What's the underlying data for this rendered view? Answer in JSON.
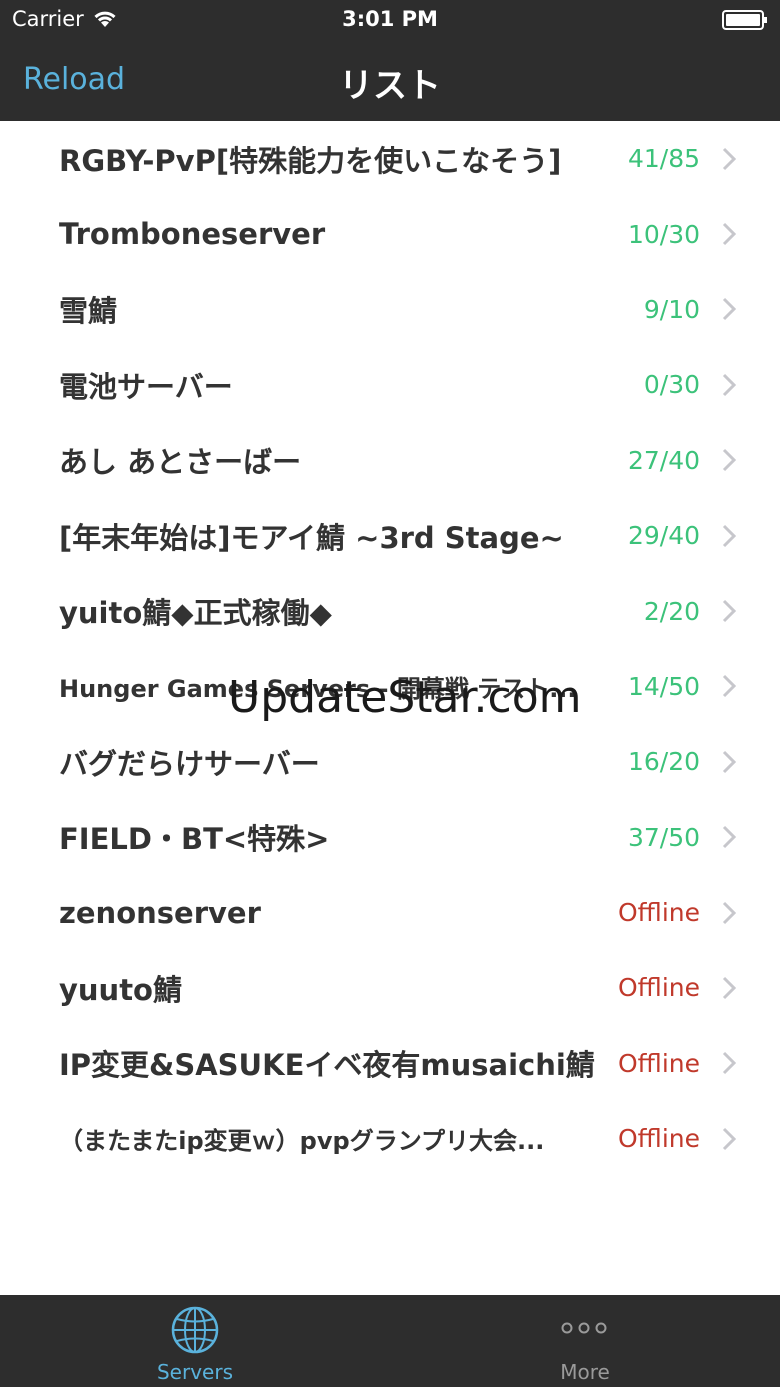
{
  "status_bar": {
    "carrier": "Carrier",
    "time": "3:01 PM"
  },
  "nav": {
    "reload_label": "Reload",
    "title": "リスト"
  },
  "servers": [
    {
      "name": "RGBY-PvP[特殊能力を使いこなそう]",
      "status": "41/85",
      "online": true
    },
    {
      "name": "Tromboneserver",
      "status": "10/30",
      "online": true
    },
    {
      "name": "雪鯖",
      "status": "9/10",
      "online": true
    },
    {
      "name": "電池サーバー",
      "status": "0/30",
      "online": true
    },
    {
      "name": "あし あとさーばー",
      "status": "27/40",
      "online": true
    },
    {
      "name": "[年末年始は]モアイ鯖 ~3rd Stage~",
      "status": "29/40",
      "online": true
    },
    {
      "name": "yuito鯖◆正式稼働◆",
      "status": "2/20",
      "online": true
    },
    {
      "name": "Hunger Games Servers - 開幕戦 テスト...",
      "status": "14/50",
      "online": true
    },
    {
      "name": "バグだらけサーバー",
      "status": "16/20",
      "online": true
    },
    {
      "name": "FIELD・BT<特殊>",
      "status": "37/50",
      "online": true
    },
    {
      "name": "zenonserver",
      "status": "Offline",
      "online": false
    },
    {
      "name": "yuuto鯖",
      "status": "Offline",
      "online": false
    },
    {
      "name": "IP変更&SASUKEイベ夜有musaichi鯖",
      "status": "Offline",
      "online": false
    },
    {
      "name": "（またまたip変更ｗ）pvpグランプリ大会...",
      "status": "Offline",
      "online": false
    }
  ],
  "watermark": "UpdateStar.com",
  "tabbar": {
    "servers_label": "Servers",
    "more_label": "More"
  },
  "colors": {
    "accent": "#5ab2dc",
    "online": "#3cc27a",
    "offline": "#c0392b",
    "bar": "#2d2d2d"
  },
  "icons": [
    "wifi-icon",
    "battery-icon",
    "chevron-right-icon",
    "globe-icon",
    "more-dots-icon"
  ]
}
